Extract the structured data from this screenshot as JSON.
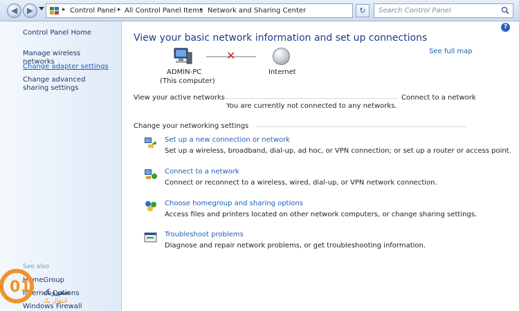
{
  "address": {
    "crumbs": [
      "Control Panel",
      "All Control Panel Items",
      "Network and Sharing Center"
    ],
    "search_placeholder": "Search Control Panel"
  },
  "leftnav": {
    "home": "Control Panel Home",
    "items": [
      "Manage wireless networks",
      "Change adapter settings",
      "Change advanced sharing settings"
    ],
    "see_also_label": "See also",
    "see_also": [
      "HomeGroup",
      "Internet Options",
      "Windows Firewall"
    ]
  },
  "watermark": {
    "logo_text": "صفروبک",
    "logo_subtext": "انتقال یک"
  },
  "main": {
    "title": "View your basic network information and set up connections",
    "see_full_map": "See full map",
    "computer_name": "ADMIN-PC",
    "computer_sub": "(This computer)",
    "internet": "Internet",
    "active_networks_label": "View your active networks",
    "connect_link": "Connect to a network",
    "not_connected": "You are currently not connected to any networks.",
    "settings_label": "Change your networking settings",
    "tasks": [
      {
        "title": "Set up a new connection or network",
        "desc": "Set up a wireless, broadband, dial-up, ad hoc, or VPN connection; or set up a router or access point."
      },
      {
        "title": "Connect to a network",
        "desc": "Connect or reconnect to a wireless, wired, dial-up, or VPN network connection."
      },
      {
        "title": "Choose homegroup and sharing options",
        "desc": "Access files and printers located on other network computers, or change sharing settings."
      },
      {
        "title": "Troubleshoot problems",
        "desc": "Diagnose and repair network problems, or get troubleshooting information."
      }
    ]
  },
  "help": "?"
}
